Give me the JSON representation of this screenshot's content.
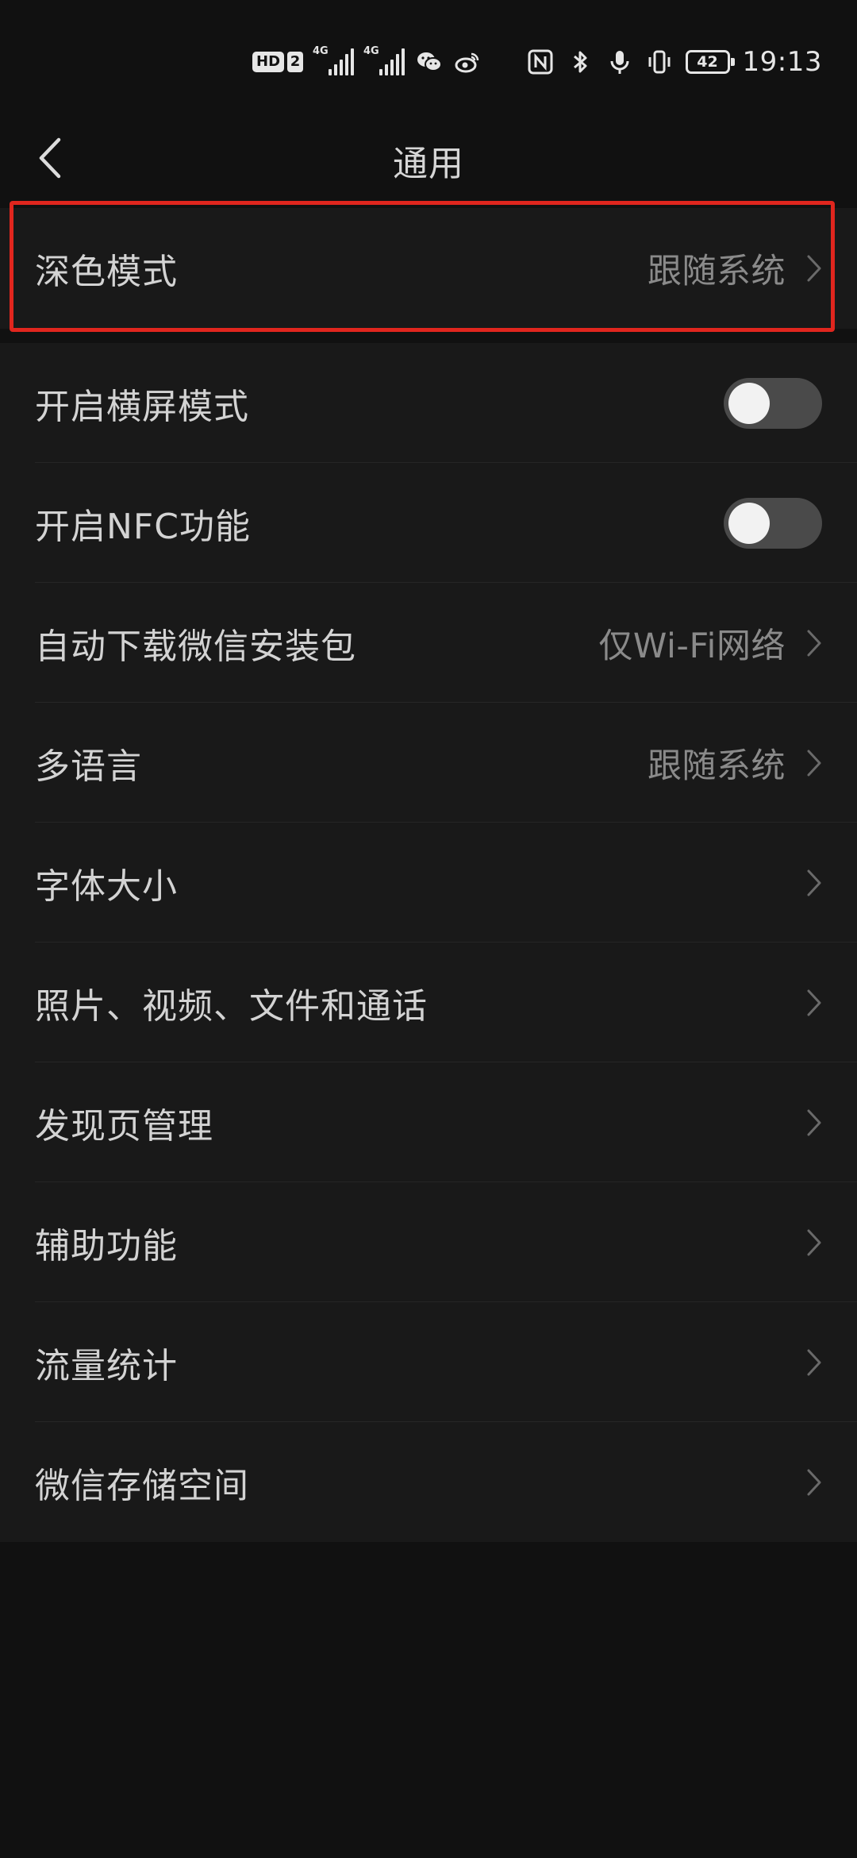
{
  "status_bar": {
    "hd_label": "HD",
    "sim_label": "2",
    "signal_1_label": "4G",
    "signal_2_label": "4G",
    "battery_level": "42",
    "time": "19:13",
    "icons": [
      "wechat-icon",
      "weibo-icon",
      "nfc-icon",
      "bluetooth-icon",
      "mic-icon",
      "vibrate-icon"
    ]
  },
  "nav": {
    "title": "通用",
    "back_icon": "chevron-left-icon"
  },
  "settings": {
    "dark_mode": {
      "label": "深色模式",
      "value": "跟随系统"
    },
    "items": [
      {
        "label": "开启横屏模式",
        "type": "toggle",
        "on": false
      },
      {
        "label": "开启NFC功能",
        "type": "toggle",
        "on": false
      },
      {
        "label": "自动下载微信安装包",
        "type": "link",
        "value": "仅Wi-Fi网络"
      },
      {
        "label": "多语言",
        "type": "link",
        "value": "跟随系统"
      },
      {
        "label": "字体大小",
        "type": "link",
        "value": ""
      },
      {
        "label": "照片、视频、文件和通话",
        "type": "link",
        "value": ""
      },
      {
        "label": "发现页管理",
        "type": "link",
        "value": ""
      },
      {
        "label": "辅助功能",
        "type": "link",
        "value": ""
      },
      {
        "label": "流量统计",
        "type": "link",
        "value": ""
      },
      {
        "label": "微信存储空间",
        "type": "link",
        "value": ""
      }
    ]
  },
  "colors": {
    "background": "#111111",
    "group_background": "#191919",
    "highlight": "#e0261e",
    "toggle_off": "#4a4a4a"
  }
}
